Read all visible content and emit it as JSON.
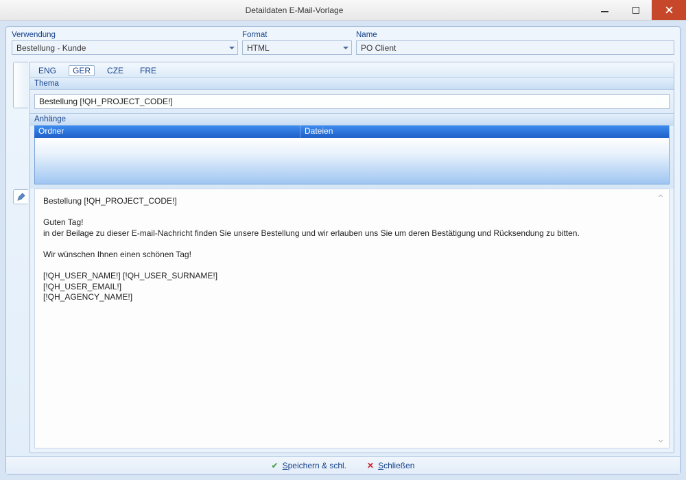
{
  "window": {
    "title": "Detaildaten E-Mail-Vorlage"
  },
  "fields": {
    "usage": {
      "label": "Verwendung",
      "value": "Bestellung - Kunde"
    },
    "format": {
      "label": "Format",
      "value": "HTML"
    },
    "name": {
      "label": "Name",
      "value": "PO Client"
    }
  },
  "lang_tabs": {
    "eng": "ENG",
    "ger": "GER",
    "cze": "CZE",
    "fre": "FRE",
    "active": "ger"
  },
  "sections": {
    "thema_label": "Thema",
    "thema_value": "Bestellung [!QH_PROJECT_CODE!]",
    "attachments_label": "Anhänge",
    "grid_cols": {
      "folder": "Ordner",
      "files": "Dateien"
    }
  },
  "editor_body": "Bestellung [!QH_PROJECT_CODE!]\n\nGuten Tag!\nin der Beilage zu dieser E-mail-Nachricht finden Sie unsere Bestellung und wir erlauben uns Sie um deren Bestätigung und Rücksendung zu bitten.\n\nWir wünschen Ihnen einen schönen Tag!\n\n[!QH_USER_NAME!] [!QH_USER_SURNAME!]\n[!QH_USER_EMAIL!]\n[!QH_AGENCY_NAME!]",
  "footer": {
    "save": {
      "label": "Speichern & schl.",
      "hotkey": "S"
    },
    "close": {
      "label": "Schließen",
      "hotkey": "S"
    }
  }
}
